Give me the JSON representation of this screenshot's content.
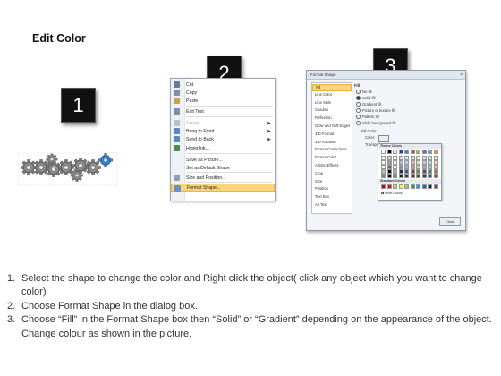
{
  "title": "Edit Color",
  "badges": [
    "1",
    "2",
    "3"
  ],
  "context_menu": {
    "items": [
      {
        "label": "Cut",
        "icon": "scissors-icon",
        "color": "#6c7a8c"
      },
      {
        "label": "Copy",
        "icon": "copy-icon",
        "color": "#7a8fb0"
      },
      {
        "label": "Paste",
        "icon": "paste-icon",
        "color": "#c9a24a"
      },
      {
        "label": "Edit Text",
        "icon": "edit-text-icon",
        "color": "#7d8fa6"
      },
      {
        "label": "Group",
        "icon": "group-icon",
        "color": "#b8bfca",
        "disabled": true,
        "submenu": true
      },
      {
        "label": "Bring to Front",
        "icon": "bring-front-icon",
        "color": "#5c86c3",
        "submenu": true
      },
      {
        "label": "Send to Back",
        "icon": "send-back-icon",
        "color": "#5c86c3",
        "submenu": true
      },
      {
        "label": "Hyperlink...",
        "icon": "hyperlink-icon",
        "color": "#4c8c4c"
      },
      {
        "label": "Save as Picture..."
      },
      {
        "label": "Set as Default Shape"
      },
      {
        "label": "Size and Position...",
        "icon": "size-position-icon",
        "color": "#8aa0be"
      },
      {
        "label": "Format Shape...",
        "icon": "format-shape-icon",
        "color": "#6b8fc9",
        "highlighted": true
      }
    ]
  },
  "dialog": {
    "title": "Format Shape",
    "close_x": "x",
    "nav_items": [
      "Fill",
      "Line Color",
      "Line Style",
      "Shadow",
      "Reflection",
      "Glow and Soft Edges",
      "3-D Format",
      "3-D Rotation",
      "Picture Corrections",
      "Picture Color",
      "Artistic Effects",
      "Crop",
      "Size",
      "Position",
      "Text Box",
      "Alt Text"
    ],
    "section": "Fill",
    "options": [
      {
        "label": "No fill",
        "on": false
      },
      {
        "label": "Solid fill",
        "on": true
      },
      {
        "label": "Gradient fill",
        "on": false
      },
      {
        "label": "Picture or texture fill",
        "on": false
      },
      {
        "label": "Pattern fill",
        "on": false
      },
      {
        "label": "Slide background fill",
        "on": false
      }
    ],
    "fill_color_label": "Fill Color",
    "color_label": "Color:",
    "transparency_label": "Transpar",
    "close_button": "Close"
  },
  "palette": {
    "theme_header": "Theme Colors",
    "standard_header": "Standard Colors",
    "more_colors": "More Colors...",
    "theme_top": [
      "#ffffff",
      "#000000",
      "#eeece1",
      "#1f497d",
      "#4f81bd",
      "#c0504d",
      "#9bbb59",
      "#8064a2",
      "#4bacc6",
      "#f79646"
    ],
    "standard": [
      "#c00000",
      "#ff0000",
      "#ffc000",
      "#ffff00",
      "#92d050",
      "#00b050",
      "#00b0f0",
      "#0070c0",
      "#002060",
      "#7030a0"
    ]
  },
  "steps": [
    {
      "num": "1.",
      "text": "Select the shape to change the color and Right click the object( click any object which you want to change color)"
    },
    {
      "num": "2.",
      "text": "Choose Format Shape in the dialog box."
    },
    {
      "num": "3.",
      "text": "Choose “Fill” in the Format Shape box then “Solid” or “Gradient” depending on the appearance of the object. Change colour as shown in the picture."
    }
  ]
}
